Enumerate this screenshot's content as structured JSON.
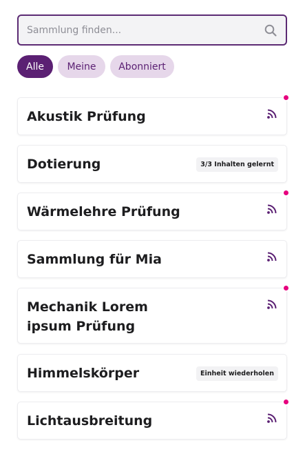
{
  "search": {
    "placeholder": "Sammlung finden..."
  },
  "filters": [
    {
      "label": "Alle",
      "active": true
    },
    {
      "label": "Meine",
      "active": false
    },
    {
      "label": "Abonniert",
      "active": false
    }
  ],
  "colors": {
    "accent": "#5b2073",
    "chip_inactive_bg": "#e6d7ea",
    "notification_dot": "#e6007e"
  },
  "collections": [
    {
      "title": "Akustik Prüfung",
      "indicator": "rss-feed-icon",
      "unread": true
    },
    {
      "title": "Dotierung",
      "badge": "3/3 Inhalten gelernt",
      "unread": false
    },
    {
      "title": "Wärmelehre Prüfung",
      "indicator": "rss-feed-icon",
      "unread": true
    },
    {
      "title": "Sammlung für Mia",
      "indicator": "rss-feed-icon",
      "unread": false
    },
    {
      "title_line1": "Mechanik Lorem",
      "title_line2": "ipsum Prüfung",
      "indicator": "rss-feed-icon",
      "unread": true
    },
    {
      "title": "Himmelskörper",
      "badge": "Einheit wiederholen",
      "unread": false
    },
    {
      "title": "Lichtausbreitung",
      "indicator": "rss-feed-icon",
      "unread": true
    }
  ]
}
